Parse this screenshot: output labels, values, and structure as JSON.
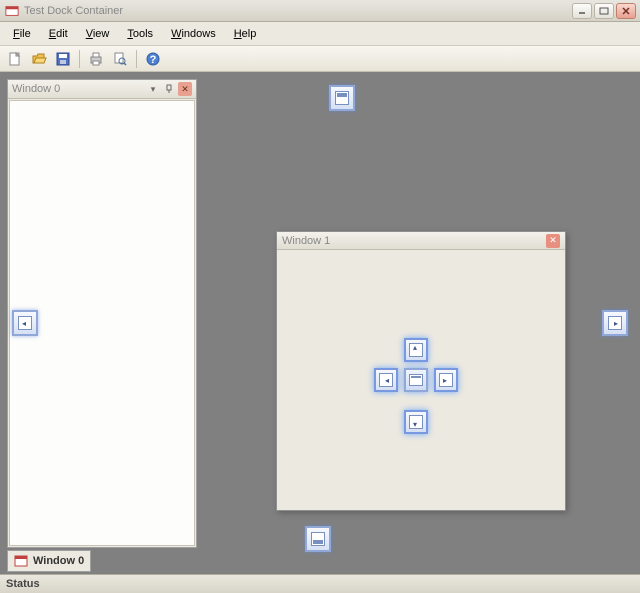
{
  "title": "Test Dock Container",
  "menu": {
    "file": "File",
    "edit": "Edit",
    "view": "View",
    "tools": "Tools",
    "windows": "Windows",
    "help": "Help"
  },
  "toolbar": {
    "new": "new-document",
    "open": "open-folder",
    "save": "save-disk",
    "print": "print",
    "preview": "print-preview",
    "help": "help"
  },
  "panel0": {
    "title": "Window 0",
    "tab": "Window 0"
  },
  "panel1": {
    "title": "Window 1"
  },
  "status": "Status"
}
